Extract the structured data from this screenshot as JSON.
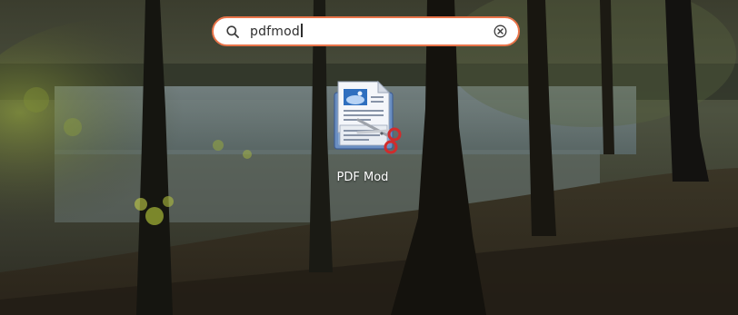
{
  "search": {
    "value": "pdfmod",
    "icon": "search-icon",
    "clear_icon": "clear-circle-icon",
    "border_color": "#e9744a"
  },
  "results": [
    {
      "label": "PDF Mod",
      "icon": "pdf-mod-app-icon"
    }
  ],
  "colors": {
    "search_accent": "#e9744a",
    "label_text": "#ffffff"
  }
}
